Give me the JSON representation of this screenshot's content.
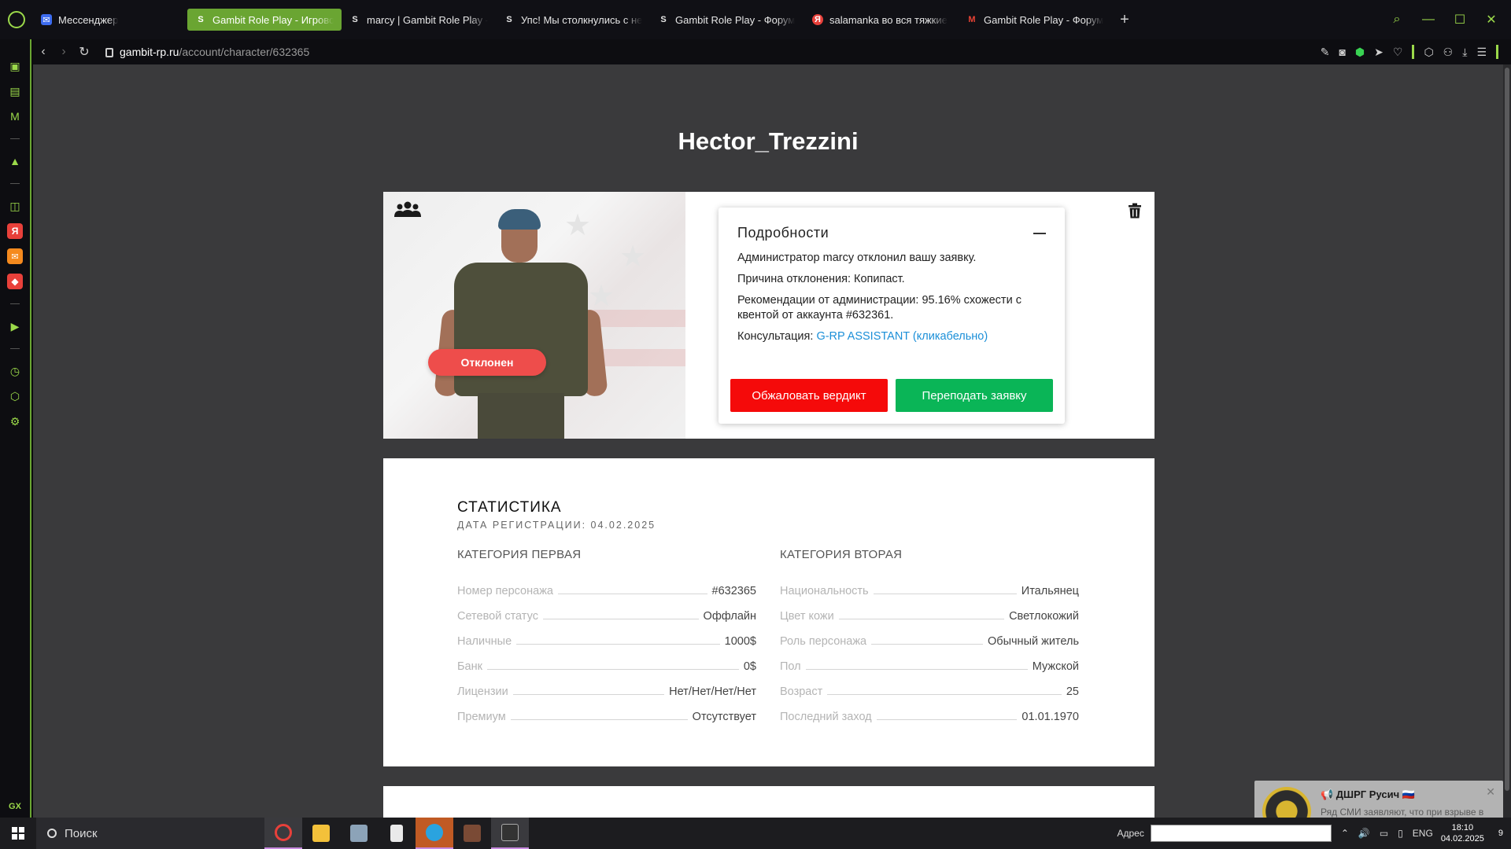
{
  "browser": {
    "tabs": [
      {
        "label": "Мессенджер",
        "icon": "messenger-icon",
        "active": false
      },
      {
        "label": "Gambit Role Play - Игровой",
        "icon": "gambit-logo-icon",
        "active": true
      },
      {
        "label": "marcy | Gambit Role Play - Ф",
        "icon": "gambit-logo-icon",
        "active": false
      },
      {
        "label": "Упс! Мы столкнулись с не",
        "icon": "gambit-logo-icon",
        "active": false
      },
      {
        "label": "Gambit Role Play - Форум",
        "icon": "gambit-logo-icon",
        "active": false
      },
      {
        "label": "salamanka во вся тяжкие",
        "icon": "yandex-icon",
        "active": false
      },
      {
        "label": "Gambit Role Play - Форум",
        "icon": "gmail-icon",
        "active": false
      }
    ],
    "url_host": "gambit-rp.ru",
    "url_path": "/account/character/632365",
    "accent": "#9bd94a"
  },
  "character": {
    "name": "Hector_Trezzini",
    "status": "Отклонен"
  },
  "details": {
    "title": "Подробности",
    "line1": "Администратор marcy отклонил вашу заявку.",
    "line2": "Причина отклонения: Копипаст.",
    "line3": "Рекомендации от администрации: 95.16% схожести с квентой от аккаунта #632361.",
    "consult_label": "Консультация: ",
    "consult_link": "G-RP ASSISTANT (кликабельно)",
    "appeal_button": "Обжаловать вердикт",
    "resubmit_button": "Переподать заявку"
  },
  "stats": {
    "title": "СТАТИСТИКА",
    "reg_date": "ДАТА РЕГИСТРАЦИИ: 04.02.2025",
    "cat1_title": "КАТЕГОРИЯ ПЕРВАЯ",
    "cat2_title": "КАТЕГОРИЯ ВТОРАЯ",
    "cat1": [
      {
        "k": "Номер персонажа",
        "v": "#632365"
      },
      {
        "k": "Сетевой статус",
        "v": "Оффлайн"
      },
      {
        "k": "Наличные",
        "v": "1000$"
      },
      {
        "k": "Банк",
        "v": "0$"
      },
      {
        "k": "Лицензии",
        "v": "Нет/Нет/Нет/Нет"
      },
      {
        "k": "Премиум",
        "v": "Отсутствует"
      }
    ],
    "cat2": [
      {
        "k": "Национальность",
        "v": "Итальянец"
      },
      {
        "k": "Цвет кожи",
        "v": "Светлокожий"
      },
      {
        "k": "Роль персонажа",
        "v": "Обычный житель"
      },
      {
        "k": "Пол",
        "v": "Мужской"
      },
      {
        "k": "Возраст",
        "v": "25"
      },
      {
        "k": "Последний заход",
        "v": "01.01.1970"
      }
    ]
  },
  "notification": {
    "title": "📢 ДШРГ Русич 🇷🇺",
    "text": "Ряд СМИ заявляют, что при взрыве в Аль-Парусах... [preview truncated]"
  },
  "taskbar": {
    "search_label": "Поиск",
    "address_label": "Адрес",
    "lang": "ENG",
    "time": "18:10",
    "date": "04.02.2025",
    "notif_count": "9"
  }
}
